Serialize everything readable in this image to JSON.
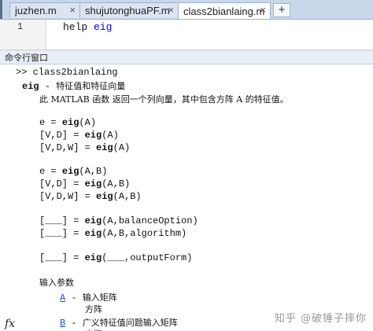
{
  "tabs": [
    {
      "label": "juzhen.m"
    },
    {
      "label": "shujutonghuaPF.m"
    },
    {
      "label": "class2bianlaing.m"
    }
  ],
  "tab_close_glyph": "×",
  "tab_add_glyph": "+",
  "editor": {
    "line_number": "1",
    "code_prefix": "help ",
    "code_keyword": "eig"
  },
  "command_window_title": "命令行窗口",
  "prompt": ">>",
  "command": "class2bianlaing",
  "help": {
    "name": "eig",
    "dash": " - ",
    "summary": "特征值和特征向量",
    "desc_prefix": "此 MATLAB 函数 返回一个列向量，其中包含方阵 A 的特征值。",
    "syntax": [
      {
        "pre": "e = ",
        "fn": "eig",
        "post": "(A)"
      },
      {
        "pre": "[V,D] = ",
        "fn": "eig",
        "post": "(A)"
      },
      {
        "pre": "[V,D,W] = ",
        "fn": "eig",
        "post": "(A)"
      },
      {
        "pre": "e = ",
        "fn": "eig",
        "post": "(A,B)"
      },
      {
        "pre": "[V,D] = ",
        "fn": "eig",
        "post": "(A,B)"
      },
      {
        "pre": "[V,D,W] = ",
        "fn": "eig",
        "post": "(A,B)"
      },
      {
        "pre": "[___] = ",
        "fn": "eig",
        "post": "(A,balanceOption)"
      },
      {
        "pre": "[___] = ",
        "fn": "eig",
        "post": "(A,B,algorithm)"
      },
      {
        "pre": "[___] = ",
        "fn": "eig",
        "post": "(___,outputForm)"
      }
    ],
    "params_heading": "输入参数",
    "params": [
      {
        "name": "A",
        "sep": " - ",
        "desc": "输入矩阵",
        "desc2": "方阵"
      },
      {
        "name": "B",
        "sep": " - ",
        "desc": "广义特征值问题输入矩阵",
        "desc2": "方阵"
      }
    ]
  },
  "fx_label": "fx",
  "watermark": "知乎 @破锤子摔你",
  "colors": {
    "link": "#1a4fd6",
    "keyword": "#0000ff",
    "tab_strip": "#c9d7ea"
  }
}
